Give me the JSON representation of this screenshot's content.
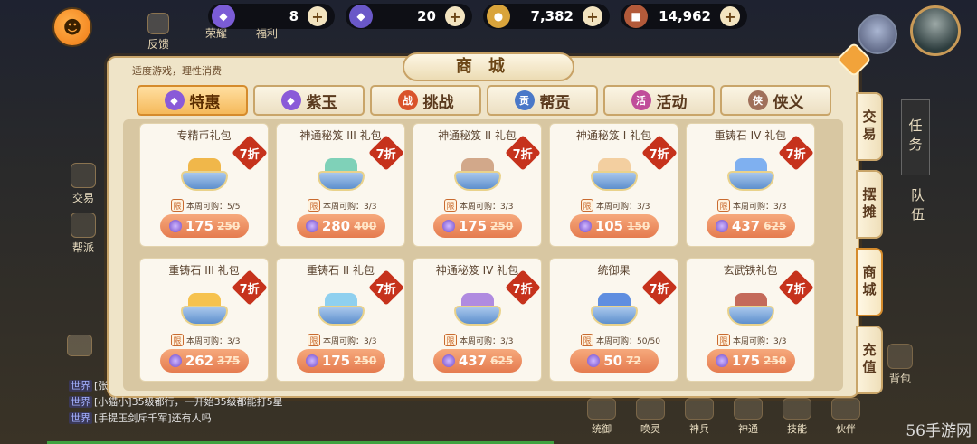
{
  "top_bar": {
    "resources": [
      {
        "icon": "purple-jade-icon",
        "value": "8",
        "color": "#7b5cd6"
      },
      {
        "icon": "bound-jade-icon",
        "value": "20",
        "color": "#6a58c8"
      },
      {
        "icon": "gold-coin-icon",
        "value": "7,382",
        "color": "#d9a43b"
      },
      {
        "icon": "copper-coin-icon",
        "value": "14,962",
        "color": "#b35a3a"
      }
    ],
    "icons": [
      {
        "name": "feedback-icon",
        "label": "反馈"
      },
      {
        "name": "honor-icon",
        "label": "荣耀"
      },
      {
        "name": "welfare-icon",
        "label": "福利"
      }
    ]
  },
  "shop": {
    "title": "商城",
    "notice": "适度游戏，理性消费",
    "tabs": [
      {
        "label": "特惠",
        "icon": "special-offer-icon",
        "color": "#8a5ad8",
        "active": true
      },
      {
        "label": "紫玉",
        "icon": "purple-jade-icon",
        "color": "#8a5ad8",
        "active": false
      },
      {
        "label": "挑战",
        "icon": "challenge-icon",
        "color": "#d9532b",
        "active": false
      },
      {
        "label": "帮贡",
        "icon": "guild-contribution-icon",
        "color": "#4a78c8",
        "active": false
      },
      {
        "label": "活动",
        "icon": "event-icon",
        "color": "#c04d9a",
        "active": false
      },
      {
        "label": "侠义",
        "icon": "chivalry-icon",
        "color": "#a0705a",
        "active": false
      }
    ],
    "side_tabs": [
      {
        "label": "交易",
        "active": false
      },
      {
        "label": "摆摊",
        "active": false
      },
      {
        "label": "商城",
        "active": true
      },
      {
        "label": "充值",
        "active": false
      }
    ],
    "limit_tag": "限",
    "items": [
      {
        "name": "专精币礼包",
        "discount": "7折",
        "limit": "本周可购：5/5",
        "price": "175",
        "old_price": "250",
        "top_color": "#f0b74a"
      },
      {
        "name": "神通秘笈 III 礼包",
        "discount": "7折",
        "limit": "本周可购：3/3",
        "price": "280",
        "old_price": "400",
        "top_color": "#7fd1b8"
      },
      {
        "name": "神通秘笈 II 礼包",
        "discount": "7折",
        "limit": "本周可购：3/3",
        "price": "175",
        "old_price": "250",
        "top_color": "#d2a88a"
      },
      {
        "name": "神通秘笈 I 礼包",
        "discount": "7折",
        "limit": "本周可购：3/3",
        "price": "105",
        "old_price": "150",
        "top_color": "#f3cfa0"
      },
      {
        "name": "重铸石 IV 礼包",
        "discount": "7折",
        "limit": "本周可购：3/3",
        "price": "437",
        "old_price": "625",
        "top_color": "#7fb0f0"
      },
      {
        "name": "重铸石 III 礼包",
        "discount": "7折",
        "limit": "本周可购：3/3",
        "price": "262",
        "old_price": "375",
        "top_color": "#f6c24e"
      },
      {
        "name": "重铸石 II 礼包",
        "discount": "7折",
        "limit": "本周可购：3/3",
        "price": "175",
        "old_price": "250",
        "top_color": "#8fd0ef"
      },
      {
        "name": "神通秘笈 IV 礼包",
        "discount": "7折",
        "limit": "本周可购：3/3",
        "price": "437",
        "old_price": "625",
        "top_color": "#b08be0"
      },
      {
        "name": "统御果",
        "discount": "7折",
        "limit": "本周可购：50/50",
        "price": "50",
        "old_price": "72",
        "top_color": "#5f8ee0"
      },
      {
        "name": "玄武铁礼包",
        "discount": "7折",
        "limit": "本周可购：3/3",
        "price": "175",
        "old_price": "250",
        "top_color": "#c46a5a"
      }
    ]
  },
  "left_column": [
    {
      "name": "trade-icon",
      "label": "交易"
    },
    {
      "name": "guild-icon",
      "label": "帮派"
    }
  ],
  "right_column": {
    "task": "任务",
    "team": "队伍"
  },
  "chat": [
    {
      "channel": "世界",
      "text": "[张"
    },
    {
      "channel": "世界",
      "text": "[小猫小]35级都行，一开始35级都能打5星"
    },
    {
      "channel": "世界",
      "text": "[手提玉剑斥千军]还有人吗"
    }
  ],
  "bottom_bar": [
    {
      "name": "command-icon",
      "label": "统御"
    },
    {
      "name": "spirit-icon",
      "label": "唤灵"
    },
    {
      "name": "divine-weapon-icon",
      "label": "神兵"
    },
    {
      "name": "divine-skill-icon",
      "label": "神通"
    },
    {
      "name": "skill-icon",
      "label": "技能"
    },
    {
      "name": "companion-icon",
      "label": "伙伴"
    }
  ],
  "bag": {
    "label": "背包"
  },
  "watermark": "56手游网"
}
